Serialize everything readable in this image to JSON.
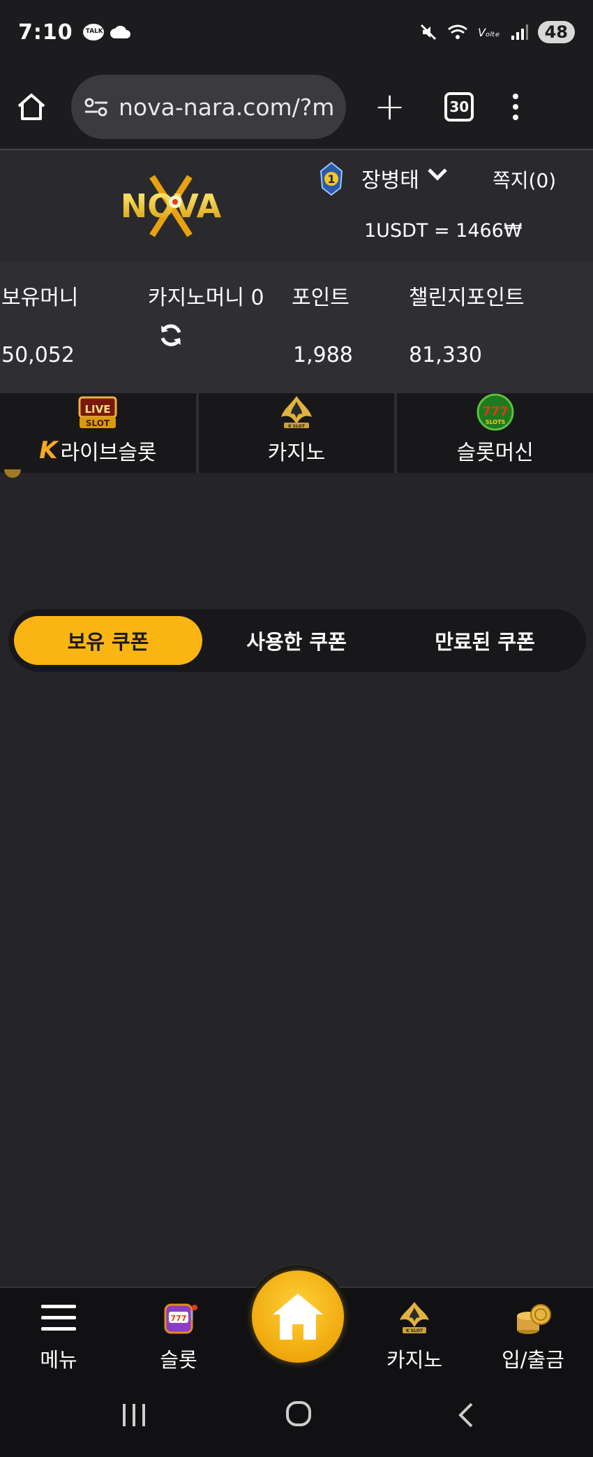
{
  "status_bar": {
    "time": "7:10",
    "talk_badge": "TALK",
    "network": "Vₒₗₜₑ",
    "battery": "48"
  },
  "browser": {
    "url": "nova-nara.com/?m",
    "tab_count": "30"
  },
  "header": {
    "logo_text": "NOVA",
    "rank": "1",
    "username": "장병태",
    "messages": "쪽지(0)",
    "rate": "1USDT = 1466₩"
  },
  "balances": {
    "holding_label": "보유머니",
    "holding_value": "50,052",
    "casino_label": "카지노머니 0",
    "point_label": "포인트",
    "point_value": "1,988",
    "challenge_label": "챌린지포인트",
    "challenge_value": "81,330"
  },
  "game_tabs": {
    "live_slot": "라이브슬롯",
    "live_icon_text": "LIVE SLOT",
    "casino": "카지노",
    "casino_icon_text": "K SLOT",
    "slot_machine": "슬롯머신",
    "slot_icon_text": "777 SLOTS"
  },
  "coupon_tabs": {
    "owned": "보유 쿠폰",
    "used": "사용한 쿠폰",
    "expired": "만료된 쿠폰",
    "active": "owned"
  },
  "bottom_nav": {
    "menu": "메뉴",
    "slot": "슬롯",
    "casino": "카지노",
    "deposit": "입/출금"
  },
  "colors": {
    "accent": "#fbb512",
    "background": "#252529",
    "header_bg": "#2a2a2e"
  }
}
